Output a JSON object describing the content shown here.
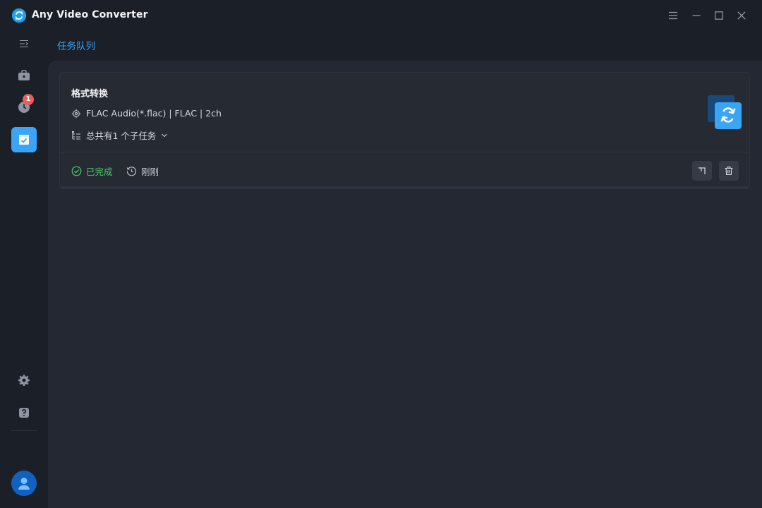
{
  "window": {
    "title": "Any Video Converter"
  },
  "sidebar": {
    "history_badge": "1"
  },
  "header": {
    "tab_label": "任务队列"
  },
  "task": {
    "title": "格式转换",
    "format_info": "FLAC Audio(*.flac) | FLAC | 2ch",
    "subtasks_label": "总共有1 个子任务",
    "status": "已完成",
    "time": "刚刚"
  },
  "colors": {
    "accent": "#3aa4f5",
    "success": "#4fcf6a",
    "badge": "#f05a5a",
    "background": "#1b1f27",
    "panel": "#242832"
  },
  "icons": {
    "app": "app-logo-icon",
    "menu": "menu-icon",
    "minimize": "minimize-icon",
    "maximize": "maximize-icon",
    "close": "close-icon",
    "collapse": "collapse-sidebar-icon",
    "toolbox": "toolbox-icon",
    "history": "clock-icon",
    "queue": "task-queue-icon",
    "settings": "gear-icon",
    "help": "help-icon",
    "user": "user-icon",
    "format": "settings-gear-icon",
    "subtasks": "list-tree-icon",
    "expand": "chevron-down-icon",
    "done": "check-circle-icon",
    "time": "history-icon",
    "open": "open-folder-icon",
    "delete": "trash-icon"
  }
}
